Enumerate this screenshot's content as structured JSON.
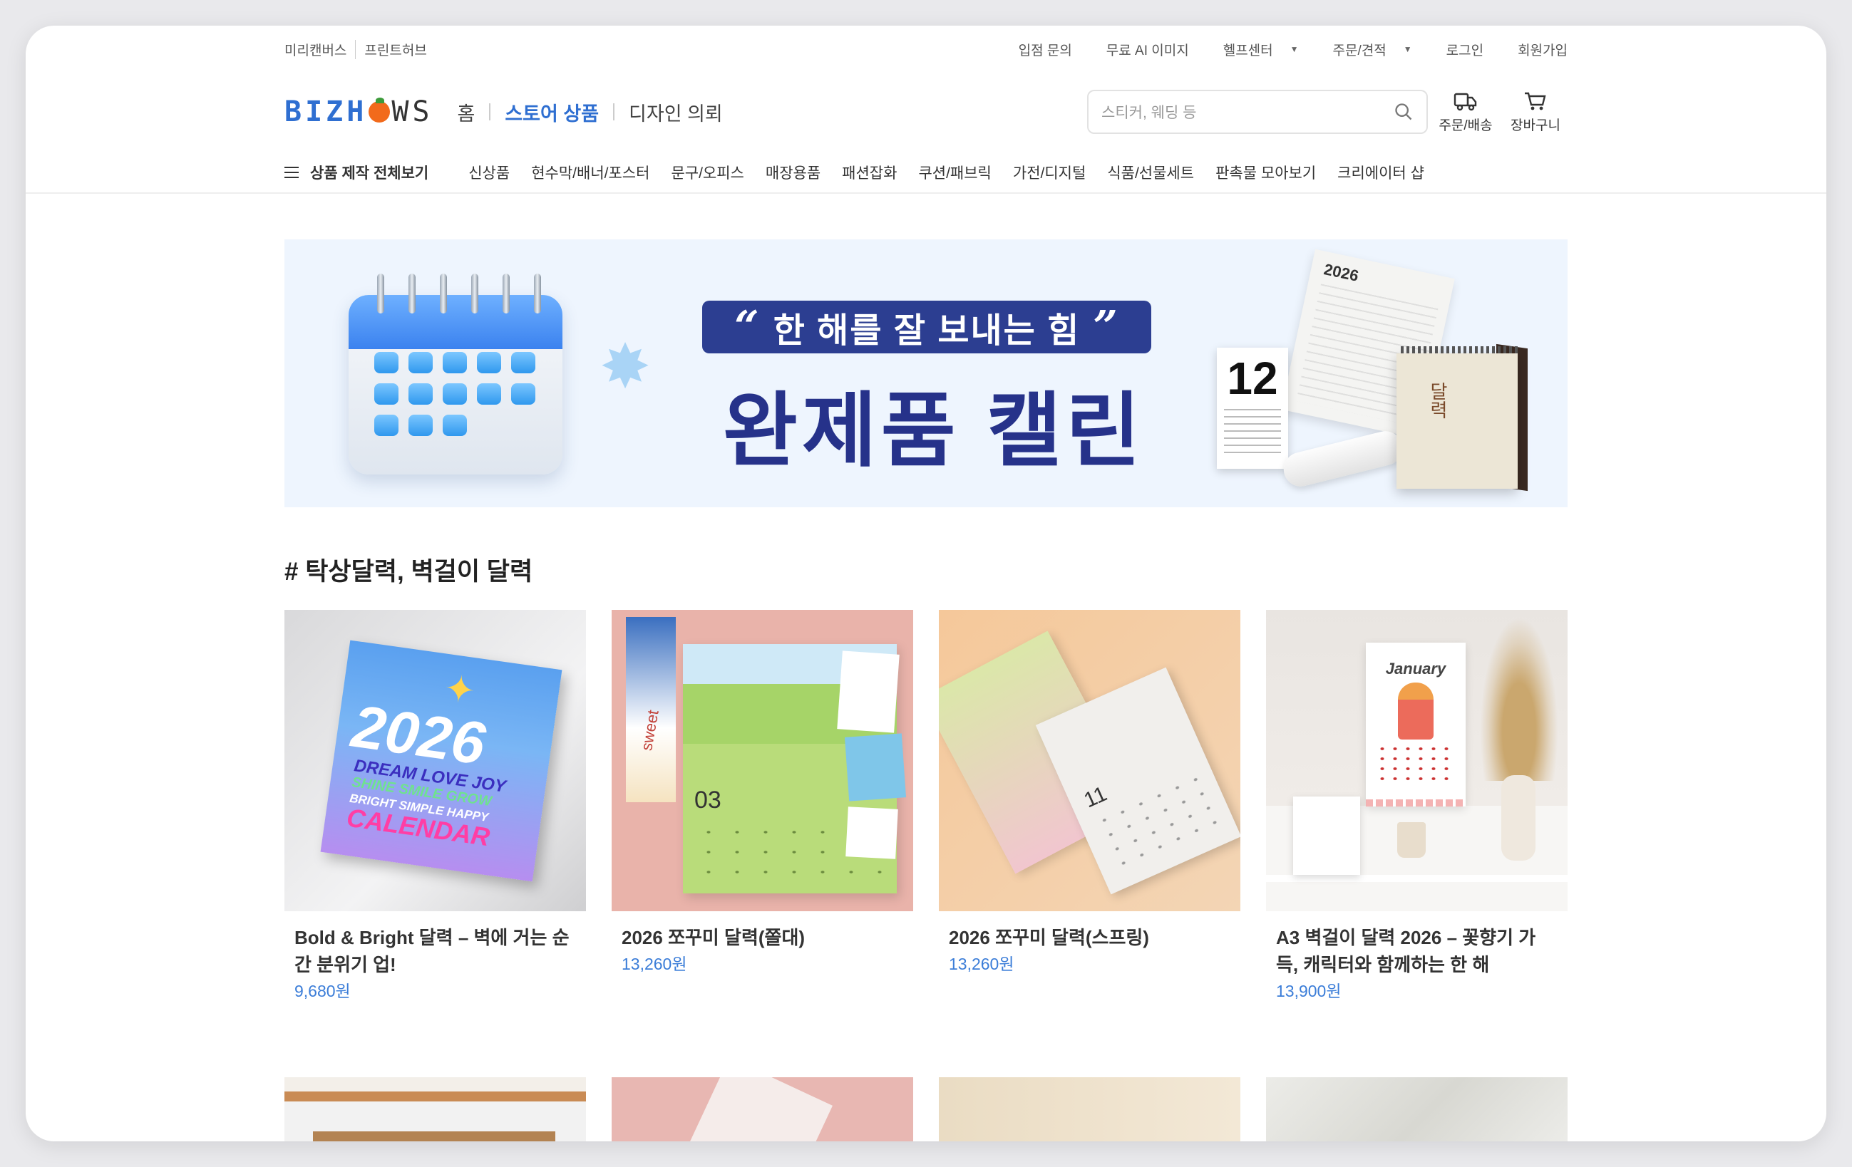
{
  "util": {
    "left_links": [
      "미리캔버스",
      "프린트허브"
    ],
    "right_links": [
      {
        "label": "입점 문의",
        "dropdown": false
      },
      {
        "label": "무료 AI 이미지",
        "dropdown": false
      },
      {
        "label": "헬프센터",
        "dropdown": true
      },
      {
        "label": "주문/견적",
        "dropdown": true
      },
      {
        "label": "로그인",
        "dropdown": false
      },
      {
        "label": "회원가입",
        "dropdown": false
      }
    ]
  },
  "header": {
    "logo": {
      "part1": "BIZH",
      "part2": "WS"
    },
    "nav": [
      "홈",
      "스토어 상품",
      "디자인 의뢰"
    ],
    "active_nav": "스토어 상품",
    "search_placeholder": "스티커, 웨딩 등",
    "actions": [
      "주문/배송",
      "장바구니"
    ]
  },
  "categories": {
    "all_label": "상품 제작 전체보기",
    "items": [
      "신상품",
      "현수막/배너/포스터",
      "문구/오피스",
      "매장용품",
      "패션잡화",
      "쿠션/패브릭",
      "가전/디지털",
      "식품/선물세트",
      "판촉물 모아보기",
      "크리에이터 샵"
    ]
  },
  "banner": {
    "quote_open": "“",
    "quote_text": "한 해를 잘 보내는 힘",
    "quote_close": "”",
    "headline": "완제품 캘린더",
    "product_year": "2026",
    "product_month": "12",
    "product_text": "달력"
  },
  "section": {
    "title": "# 탁상달력, 벽걸이 달력",
    "products": [
      {
        "name": "Bold & Bright 달력 – 벽에 거는 순간 분위기 업!",
        "price": "9,680원"
      },
      {
        "name": "2026 쪼꾸미 달력(쫄대)",
        "price": "13,260원"
      },
      {
        "name": "2026 쪼꾸미 달력(스프링)",
        "price": "13,260원"
      },
      {
        "name": "A3 벽걸이 달력 2026 – 꽃향기 가득, 캐릭터와 함께하는 한 해",
        "price": "13,900원"
      }
    ]
  },
  "thumbs": {
    "p1": {
      "year": "2026",
      "line1": "DREAM LOVE JOY",
      "line2": "SHINE SMILE GROW",
      "line3": "BRIGHT SIMPLE HAPPY",
      "line4": "CALENDAR"
    },
    "p2": {
      "month": "03",
      "poster_text": "sweet"
    },
    "p3": {
      "month": "11"
    },
    "p4": {
      "month": "January"
    }
  },
  "colors": {
    "accent": "#2f6fd1",
    "price": "#3b7dd8",
    "banner_bg": "#eef5fe",
    "banner_navy": "#26328a"
  }
}
